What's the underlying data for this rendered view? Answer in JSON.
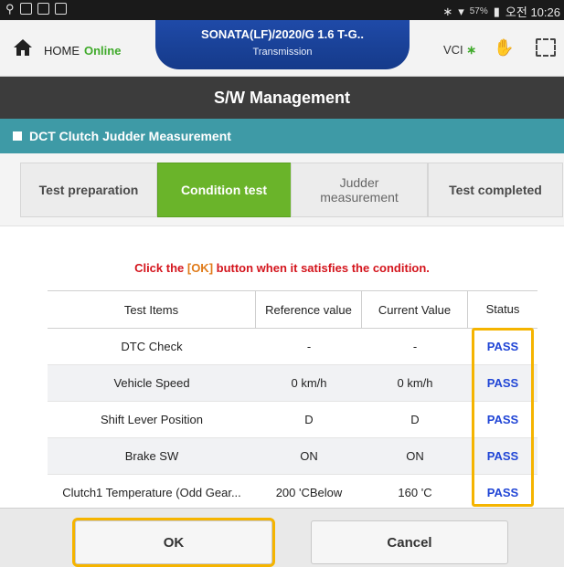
{
  "statusbar": {
    "battery_text": "57%",
    "time": "오전 10:26"
  },
  "header": {
    "home_label": "HOME",
    "connection_status": "Online",
    "vehicle_title": "SONATA(LF)/2020/G 1.6 T-G..",
    "vehicle_system": "Transmission",
    "vci_label": "VCI"
  },
  "title": "S/W Management",
  "section_title": "DCT Clutch Judder Measurement",
  "steps": [
    {
      "label": "Test preparation"
    },
    {
      "label": "Condition test"
    },
    {
      "label": "Judder measurement"
    },
    {
      "label": "Test completed"
    }
  ],
  "instruction": {
    "before": "Click the ",
    "ok": "[OK]",
    "after": " button when it satisfies the condition."
  },
  "table": {
    "headers": [
      "Test Items",
      "Reference value",
      "Current Value",
      "Status"
    ],
    "rows": [
      [
        "DTC Check",
        "-",
        "-",
        "PASS"
      ],
      [
        "Vehicle Speed",
        "0 km/h",
        "0 km/h",
        "PASS"
      ],
      [
        "Shift Lever Position",
        "D",
        "D",
        "PASS"
      ],
      [
        "Brake SW",
        "ON",
        "ON",
        "PASS"
      ],
      [
        "Clutch1 Temperature (Odd Gear...",
        "200 'CBelow",
        "160 'C",
        "PASS"
      ]
    ]
  },
  "buttons": {
    "ok": "OK",
    "cancel": "Cancel"
  },
  "colors": {
    "active_step": "#6ab42a",
    "section_bar": "#3e9aa6",
    "vehicle_banner": "#1f4aa8",
    "pass": "#2146d6",
    "highlight": "#f5b400"
  }
}
